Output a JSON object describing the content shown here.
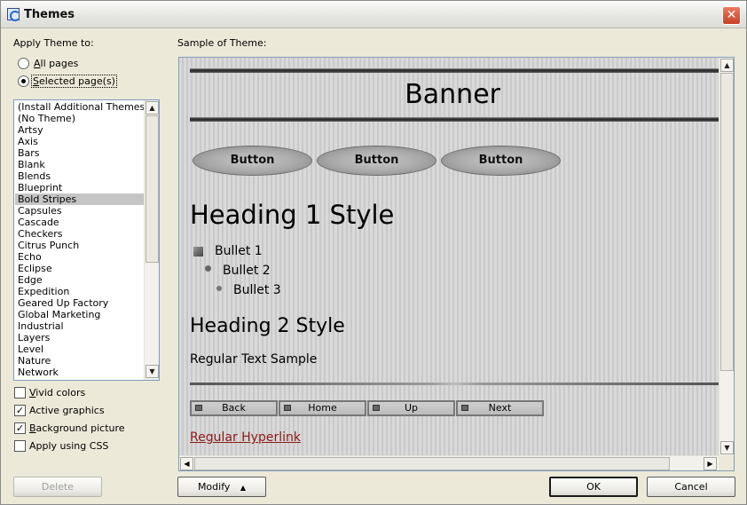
{
  "window": {
    "title": "Themes",
    "close_symbol": "✕"
  },
  "apply": {
    "label": "Apply Theme to:",
    "all_pages": {
      "accel": "A",
      "rest": "ll pages"
    },
    "selected_pages": {
      "accel": "S",
      "rest": "elected page(s)"
    }
  },
  "sample_label": "Sample of Theme:",
  "themes": [
    "(Install Additional Themes)",
    "(No Theme)",
    "Artsy",
    "Axis",
    "Bars",
    "Blank",
    "Blends",
    "Blueprint",
    "Bold Stripes",
    "Capsules",
    "Cascade",
    "Checkers",
    "Citrus Punch",
    "Echo",
    "Eclipse",
    "Edge",
    "Expedition",
    "Geared Up Factory",
    "Global Marketing",
    "Industrial",
    "Layers",
    "Level",
    "Nature",
    "Network"
  ],
  "selected_theme": "Bold Stripes",
  "options": {
    "vivid": {
      "accel": "V",
      "rest": "ivid colors",
      "checked": false
    },
    "active": {
      "accel": "",
      "rest": "Active graphics",
      "checked": true
    },
    "background": {
      "accel": "B",
      "rest": "ackground picture",
      "checked": true
    },
    "css": {
      "accel": "",
      "rest": "Apply using CSS",
      "checked": false
    }
  },
  "buttons": {
    "delete": "Delete",
    "modify": "Modify",
    "modify_arrow": "▲",
    "ok": "OK",
    "cancel": "Cancel"
  },
  "preview": {
    "banner": "Banner",
    "buttons": [
      "Button",
      "Button",
      "Button"
    ],
    "heading1": "Heading 1 Style",
    "bullets": [
      "Bullet 1",
      "Bullet 2",
      "Bullet 3"
    ],
    "heading2": "Heading 2 Style",
    "regular": "Regular Text Sample",
    "nav": [
      "Back",
      "Home",
      "Up",
      "Next"
    ],
    "hyperlink": "Regular Hyperlink"
  },
  "colors": {
    "hyperlink": "#8b1a1a",
    "selection": "#c5c5c5",
    "close_button": "#c8402a"
  },
  "icons": {
    "window": "themes-app-icon",
    "close": "close-icon",
    "scroll_up": "arrow-up-icon",
    "scroll_down": "arrow-down-icon"
  }
}
